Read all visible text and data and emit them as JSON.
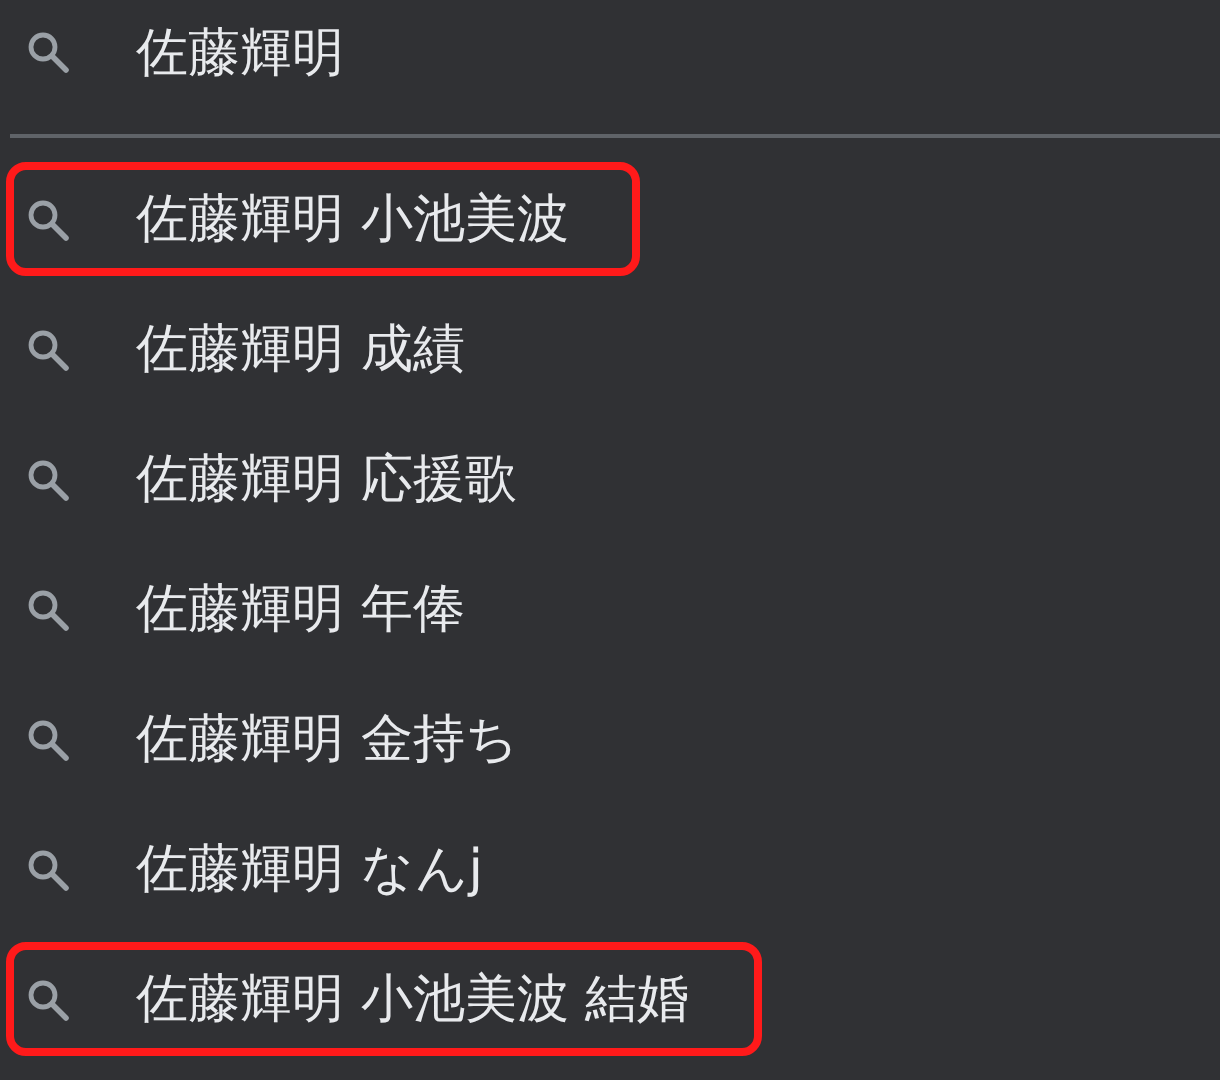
{
  "query": {
    "text": "佐藤輝明"
  },
  "suggestions": [
    {
      "text": "佐藤輝明 小池美波",
      "highlighted": true
    },
    {
      "text": "佐藤輝明 成績",
      "highlighted": false
    },
    {
      "text": "佐藤輝明 応援歌",
      "highlighted": false
    },
    {
      "text": "佐藤輝明 年俸",
      "highlighted": false
    },
    {
      "text": "佐藤輝明 金持ち",
      "highlighted": false
    },
    {
      "text": "佐藤輝明 なんj",
      "highlighted": false
    },
    {
      "text": "佐藤輝明 小池美波 結婚",
      "highlighted": true
    }
  ]
}
